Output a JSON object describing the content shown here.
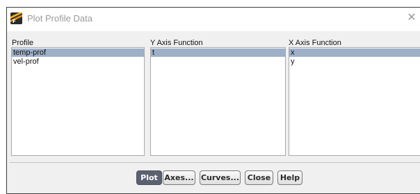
{
  "window": {
    "title": "Plot Profile Data",
    "close_glyph": "✕"
  },
  "profile": {
    "label": "Profile",
    "items": [
      "temp-prof",
      "vel-prof"
    ],
    "selected": "temp-prof"
  },
  "y_axis": {
    "label": "Y Axis Function",
    "items": [
      "t"
    ],
    "selected": "t"
  },
  "x_axis": {
    "label": "X Axis Function",
    "items": [
      "x",
      "y"
    ],
    "selected": "x"
  },
  "buttons": {
    "plot": "Plot",
    "axes": "Axes...",
    "curves": "Curves...",
    "close": "Close",
    "help": "Help"
  },
  "colors": {
    "selection": "#9db0c8",
    "default_button": "#5b6170",
    "dialog_background": "#f0f0f0"
  },
  "icons": {
    "app": "fluent-app-icon",
    "close": "close-icon"
  }
}
